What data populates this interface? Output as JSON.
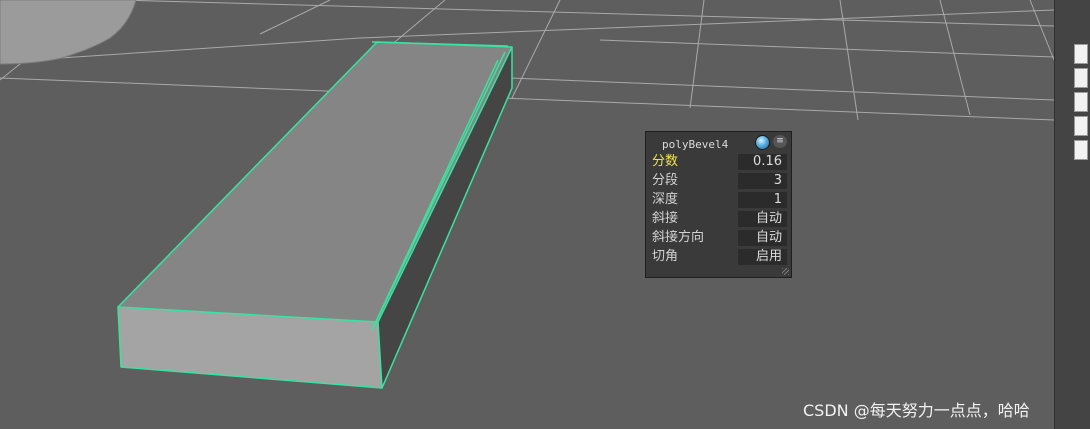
{
  "hud": {
    "title": "polyBevel4",
    "menu_glyph": "≡",
    "rows": [
      {
        "label": "分数",
        "value": "0.16"
      },
      {
        "label": "分段",
        "value": "3"
      },
      {
        "label": "深度",
        "value": "1"
      },
      {
        "label": "斜接",
        "value": "自动"
      },
      {
        "label": "斜接方向",
        "value": "自动"
      },
      {
        "label": "切角",
        "value": "启用"
      }
    ],
    "active_label_color": "#f2e24a"
  },
  "viewport": {
    "background_color": "#5e5e5e",
    "selection_highlight_color": "#38e3a1"
  },
  "watermark": "CSDN @每天努力一点点，哈哈"
}
